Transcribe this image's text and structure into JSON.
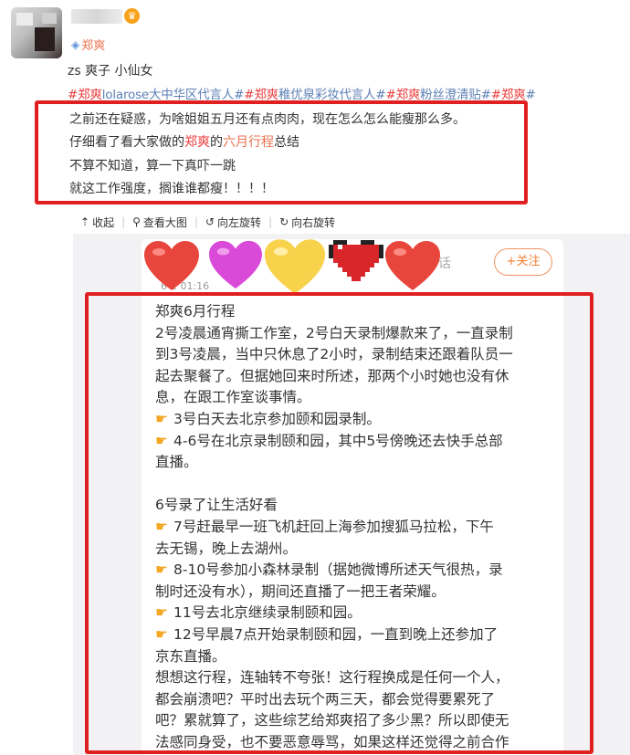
{
  "post": {
    "topic_tag": "郑爽",
    "line1": "zs 爽子 小仙女",
    "hashtags": [
      {
        "text": "#郑爽",
        "color": "red"
      },
      {
        "text": "lolarose大中华区代言人#",
        "color": "blue"
      },
      {
        "text": "#郑爽",
        "color": "red"
      },
      {
        "text": "稚优泉彩妆代言人#",
        "color": "blue"
      },
      {
        "text": "#郑爽",
        "color": "red"
      },
      {
        "text": "粉丝澄清贴#",
        "color": "blue"
      },
      {
        "text": "#郑爽",
        "color": "red"
      },
      {
        "text": "#",
        "color": "blue"
      }
    ],
    "body": {
      "l1": "之前还在疑惑，为啥姐姐五月还有点肉肉，现在怎么怎么能瘦那么多。",
      "l2_a": "仔细看了看大家做的",
      "l2_b": "郑爽",
      "l2_c": "的",
      "l2_d": "六月行程",
      "l2_e": "总结",
      "l3": "不算不知道，算一下真吓一跳",
      "l4": "就这工作强度，搁谁谁都瘦！！！！"
    }
  },
  "actions": {
    "collapse": "收起",
    "view_large": "查看大图",
    "rotate_left": "向左旋转",
    "rotate_right": "向右旋转"
  },
  "image": {
    "faded_time": "6-1  01:16",
    "faded_word": "话",
    "follow": "+关注",
    "schedule_lines": [
      "郑爽6月行程",
      "2号凌晨通宵撕工作室，2号白天录制爆款来了，一直录制",
      "到3号凌晨，当中只休息了2小时，录制结束还跟着队员一",
      "起去聚餐了。但据她回来时所述，那两个小时她也没有休",
      "息，在跟工作室谈事情。",
      "3号白天去北京参加颐和园录制。",
      "4-6号在北京录制颐和园，其中5号傍晚还去快手总部",
      "直播。",
      "",
      "6号录了让生活好看",
      "7号赶最早一班飞机赶回上海参加搜狐马拉松，下午",
      "去无锡，晚上去湖州。",
      "8-10号参加小森林录制（据她微博所述天气很热，录",
      "制时还没有水），期间还直播了一把王者荣耀。",
      "11号去北京继续录制颐和园。",
      "12号早晨7点开始录制颐和园，一直到晚上还参加了",
      "京东直播。",
      "想想这行程，连轴转不夸张！这行程换成是任何一个人，",
      "都会崩溃吧？平时出去玩个两三天，都会觉得要累死了",
      "吧？累就算了，这些综艺给郑爽招了多少黑？所以即使无",
      "法感同身受，也不要恶意辱骂，如果这样还觉得之前合作"
    ],
    "hand_lines": [
      5,
      6,
      10,
      12,
      14,
      15
    ]
  },
  "colors": {
    "highlight_red": "#e02020",
    "tag_orange": "#eb7350",
    "hashtag_blue": "#5d7fb5",
    "hashtag_red": "#eb3b3b"
  }
}
